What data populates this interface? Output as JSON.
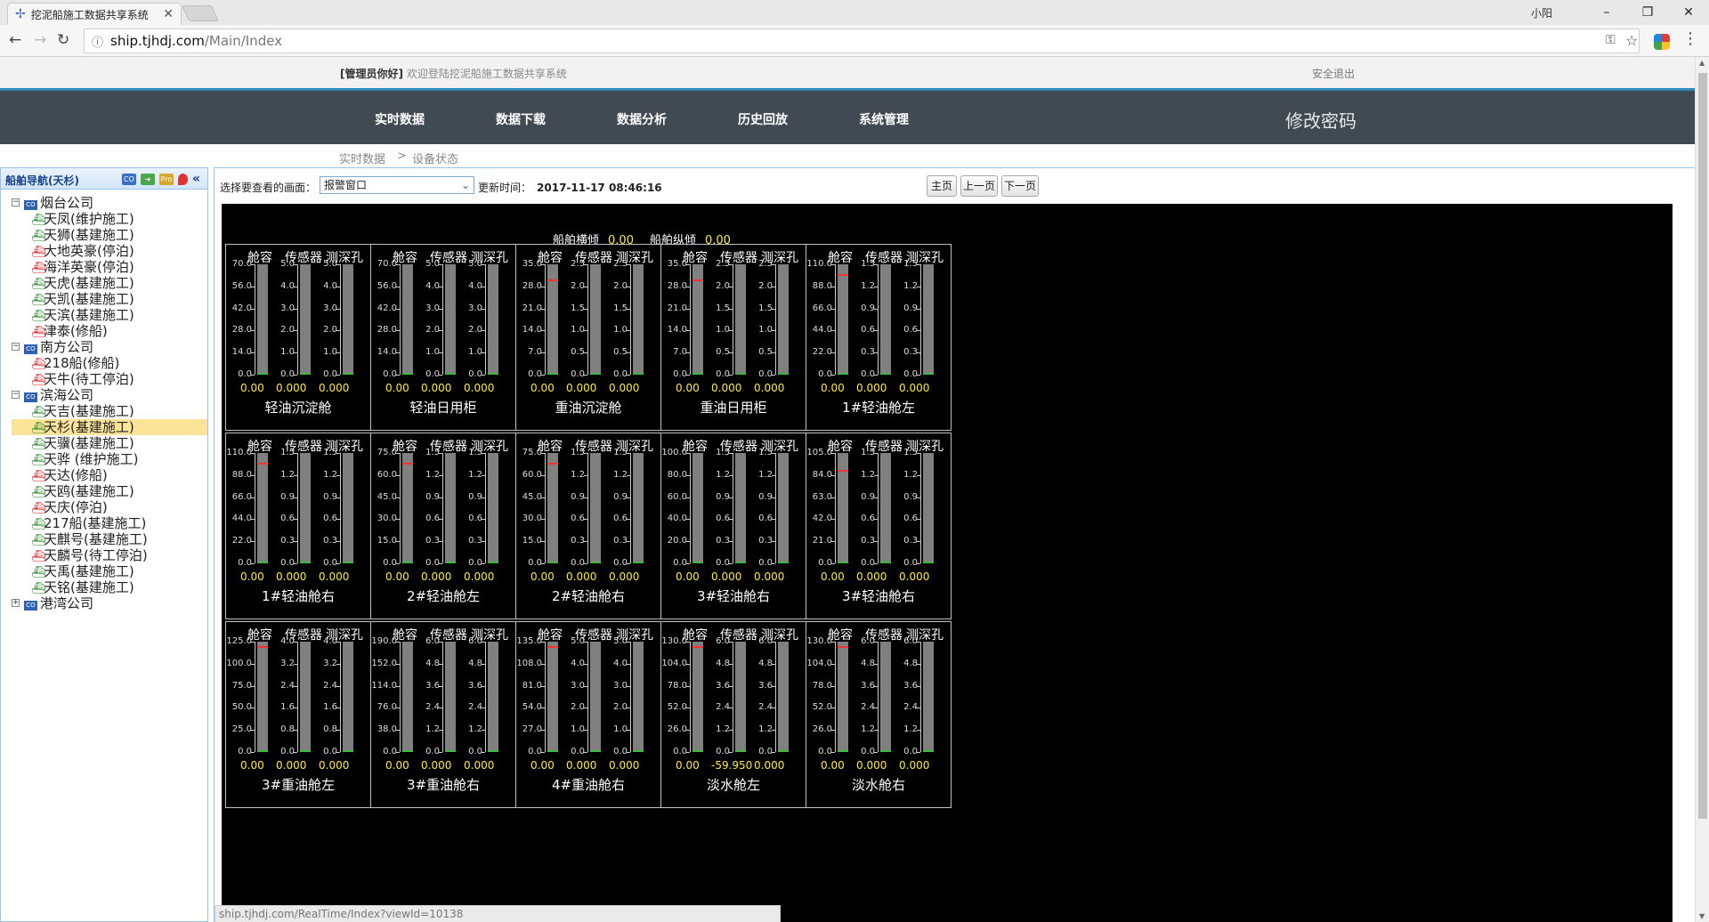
{
  "browser": {
    "tab_title": "挖泥船施工数据共享系统",
    "tab_icon": "ship-icon",
    "user": "小阳",
    "url_host": "ship.tjhdj.com",
    "url_path": "/Main/Index"
  },
  "header": {
    "greeting_bold": "[管理员你好]",
    "greeting": "欢迎登陆挖泥船施工数据共享系统",
    "logout": "安全退出"
  },
  "nav": {
    "items": [
      "实时数据",
      "数据下载",
      "数据分析",
      "历史回放",
      "系统管理"
    ],
    "change_password": "修改密码"
  },
  "breadcrumb": {
    "root": "实时数据",
    "sep": ">",
    "current": "设备状态"
  },
  "sidebar": {
    "title": "船舶导航(天杉)",
    "toggle": "«",
    "tree": [
      {
        "company": "烟台公司",
        "expanded": true,
        "ships": [
          "天凤(维护施工)",
          "天狮(基建施工)",
          "大地英豪(停泊)",
          "海洋英豪(停泊)",
          "天虎(基建施工)",
          "天凯(基建施工)",
          "天滨(基建施工)",
          "津泰(修船)"
        ]
      },
      {
        "company": "南方公司",
        "expanded": true,
        "ships": [
          "218船(修船)",
          "天牛(待工停泊)"
        ]
      },
      {
        "company": "滨海公司",
        "expanded": true,
        "ships": [
          "天吉(基建施工)",
          "天杉(基建施工)",
          "天骥(基建施工)",
          "天骅 (维护施工)",
          "天达(修船)",
          "天鸥(基建施工)",
          "天庆(停泊)",
          "217船(基建施工)",
          "天麒号(基建施工)",
          "天麟号(待工停泊)",
          "天禹(基建施工)",
          "天铭(基建施工)"
        ]
      },
      {
        "company": "港湾公司",
        "expanded": false,
        "ships": []
      }
    ],
    "selected": "天杉(基建施工)"
  },
  "toolbar": {
    "select_label": "选择要查看的画面：",
    "select_value": "报警窗口",
    "update_label": "更新时间：",
    "update_time": "2017-11-17 08:46:16",
    "btn_home": "主页",
    "btn_prev": "上一页",
    "btn_next": "下一页"
  },
  "display": {
    "heel_label": "船舶横倾",
    "heel_value": "0.00",
    "trim_label": "船舶纵倾",
    "trim_value": "0.00",
    "col_headers": [
      "舱容",
      "传感器",
      "测深孔"
    ],
    "tanks": [
      {
        "name": "轻油沉淀舱",
        "values": [
          "0.00",
          "0.000",
          "0.000"
        ],
        "ticks": [
          [
            "70.0",
            "56.0",
            "42.0",
            "28.0",
            "14.0",
            "0.0"
          ],
          [
            "5.0",
            "4.0",
            "3.0",
            "2.0",
            "1.0",
            "0.0"
          ],
          [
            "5.0",
            "4.0",
            "3.0",
            "2.0",
            "1.0",
            "0.0"
          ]
        ],
        "level": 0
      },
      {
        "name": "轻油日用柜",
        "values": [
          "0.00",
          "0.000",
          "0.000"
        ],
        "ticks": [
          [
            "70.0",
            "56.0",
            "42.0",
            "28.0",
            "14.0",
            "0.0"
          ],
          [
            "5.0",
            "4.0",
            "3.0",
            "2.0",
            "1.0",
            "0.0"
          ],
          [
            "5.0",
            "4.0",
            "3.0",
            "2.0",
            "1.0",
            "0.0"
          ]
        ],
        "level": 0
      },
      {
        "name": "重油沉淀舱",
        "values": [
          "0.00",
          "0.000",
          "0.000"
        ],
        "ticks": [
          [
            "35.0",
            "28.0",
            "21.0",
            "14.0",
            "7.0",
            "0.0"
          ],
          [
            "2.5",
            "2.0",
            "1.5",
            "1.0",
            "0.5",
            "0.0"
          ],
          [
            "2.5",
            "2.0",
            "1.5",
            "1.0",
            "0.5",
            "0.0"
          ]
        ],
        "level": 0.86
      },
      {
        "name": "重油日用柜",
        "values": [
          "0.00",
          "0.000",
          "0.000"
        ],
        "ticks": [
          [
            "35.0",
            "28.0",
            "21.0",
            "14.0",
            "7.0",
            "0.0"
          ],
          [
            "2.5",
            "2.0",
            "1.5",
            "1.0",
            "0.5",
            "0.0"
          ],
          [
            "2.5",
            "2.0",
            "1.5",
            "1.0",
            "0.5",
            "0.0"
          ]
        ],
        "level": 0.86
      },
      {
        "name": "1#轻油舱左",
        "values": [
          "0.00",
          "0.000",
          "0.000"
        ],
        "ticks": [
          [
            "110.0",
            "88.0",
            "66.0",
            "44.0",
            "22.0",
            "0.0"
          ],
          [
            "1.5",
            "1.2",
            "0.9",
            "0.6",
            "0.3",
            "0.0"
          ],
          [
            "1.5",
            "1.2",
            "0.9",
            "0.6",
            "0.3",
            "0.0"
          ]
        ],
        "level": 0.91
      },
      {
        "name": "1#轻油舱右",
        "values": [
          "0.00",
          "0.000",
          "0.000"
        ],
        "ticks": [
          [
            "110.0",
            "88.0",
            "66.0",
            "44.0",
            "22.0",
            "0.0"
          ],
          [
            "1.5",
            "1.2",
            "0.9",
            "0.6",
            "0.3",
            "0.0"
          ],
          [
            "1.5",
            "1.2",
            "0.9",
            "0.6",
            "0.3",
            "0.0"
          ]
        ],
        "level": 0.91
      },
      {
        "name": "2#轻油舱左",
        "values": [
          "0.00",
          "0.000",
          "0.000"
        ],
        "ticks": [
          [
            "75.0",
            "60.0",
            "45.0",
            "30.0",
            "15.0",
            "0.0"
          ],
          [
            "1.5",
            "1.2",
            "0.9",
            "0.6",
            "0.3",
            "0.0"
          ],
          [
            "1.5",
            "1.2",
            "0.9",
            "0.6",
            "0.3",
            "0.0"
          ]
        ],
        "level": 0.91
      },
      {
        "name": "2#轻油舱右",
        "values": [
          "0.00",
          "0.000",
          "0.000"
        ],
        "ticks": [
          [
            "75.0",
            "60.0",
            "45.0",
            "30.0",
            "15.0",
            "0.0"
          ],
          [
            "1.5",
            "1.2",
            "0.9",
            "0.6",
            "0.3",
            "0.0"
          ],
          [
            "1.5",
            "1.2",
            "0.9",
            "0.6",
            "0.3",
            "0.0"
          ]
        ],
        "level": 0.91
      },
      {
        "name": "3#轻油舱右",
        "values": [
          "0.00",
          "0.000",
          "0.000"
        ],
        "ticks": [
          [
            "100.0",
            "80.0",
            "60.0",
            "40.0",
            "20.0",
            "0.0"
          ],
          [
            "1.5",
            "1.2",
            "0.9",
            "0.6",
            "0.3",
            "0.0"
          ],
          [
            "1.5",
            "1.2",
            "0.9",
            "0.6",
            "0.3",
            "0.0"
          ]
        ],
        "level": 0
      },
      {
        "name": "3#轻油舱右",
        "values": [
          "0.00",
          "0.000",
          "0.000"
        ],
        "ticks": [
          [
            "105.0",
            "84.0",
            "63.0",
            "42.0",
            "21.0",
            "0.0"
          ],
          [
            "1.5",
            "1.2",
            "0.9",
            "0.6",
            "0.3",
            "0.0"
          ],
          [
            "1.5",
            "1.2",
            "0.9",
            "0.6",
            "0.3",
            "0.0"
          ]
        ],
        "level": 0.85
      },
      {
        "name": "3#重油舱左",
        "values": [
          "0.00",
          "0.000",
          "0.000"
        ],
        "ticks": [
          [
            "125.0",
            "100.0",
            "75.0",
            "50.0",
            "25.0",
            "0.0"
          ],
          [
            "4.0",
            "3.2",
            "2.4",
            "1.6",
            "0.8",
            "0.0"
          ],
          [
            "4.0",
            "3.2",
            "2.4",
            "1.6",
            "0.8",
            "0.0"
          ]
        ],
        "level": 0.96
      },
      {
        "name": "3#重油舱右",
        "values": [
          "0.00",
          "0.000",
          "0.000"
        ],
        "ticks": [
          [
            "190.0",
            "152.0",
            "114.0",
            "76.0",
            "38.0",
            "0.0"
          ],
          [
            "6.0",
            "4.8",
            "3.6",
            "2.4",
            "1.2",
            "0.0"
          ],
          [
            "6.0",
            "4.8",
            "3.6",
            "2.4",
            "1.2",
            "0.0"
          ]
        ],
        "level": 0
      },
      {
        "name": "4#重油舱右",
        "values": [
          "0.00",
          "0.000",
          "0.000"
        ],
        "ticks": [
          [
            "135.0",
            "108.0",
            "81.0",
            "54.0",
            "27.0",
            "0.0"
          ],
          [
            "5.0",
            "4.0",
            "3.0",
            "2.0",
            "1.0",
            "0.0"
          ],
          [
            "5.0",
            "4.0",
            "3.0",
            "2.0",
            "1.0",
            "0.0"
          ]
        ],
        "level": 0.96
      },
      {
        "name": "淡水舱左",
        "values": [
          "0.00",
          "-59.950",
          "0.000"
        ],
        "ticks": [
          [
            "130.0",
            "104.0",
            "78.0",
            "52.0",
            "26.0",
            "0.0"
          ],
          [
            "6.0",
            "4.8",
            "3.6",
            "2.4",
            "1.2",
            "0.0"
          ],
          [
            "6.0",
            "4.8",
            "3.6",
            "2.4",
            "1.2",
            "0.0"
          ]
        ],
        "level": 0.96
      },
      {
        "name": "淡水舱右",
        "values": [
          "0.00",
          "0.000",
          "0.000"
        ],
        "ticks": [
          [
            "130.0",
            "104.0",
            "78.0",
            "52.0",
            "26.0",
            "0.0"
          ],
          [
            "6.0",
            "4.8",
            "3.6",
            "2.4",
            "1.2",
            "0.0"
          ],
          [
            "6.0",
            "4.8",
            "3.6",
            "2.4",
            "1.2",
            "0.0"
          ]
        ],
        "level": 0.96
      }
    ]
  },
  "status_url": "ship.tjhdj.com/RealTime/Index?viewId=10138"
}
